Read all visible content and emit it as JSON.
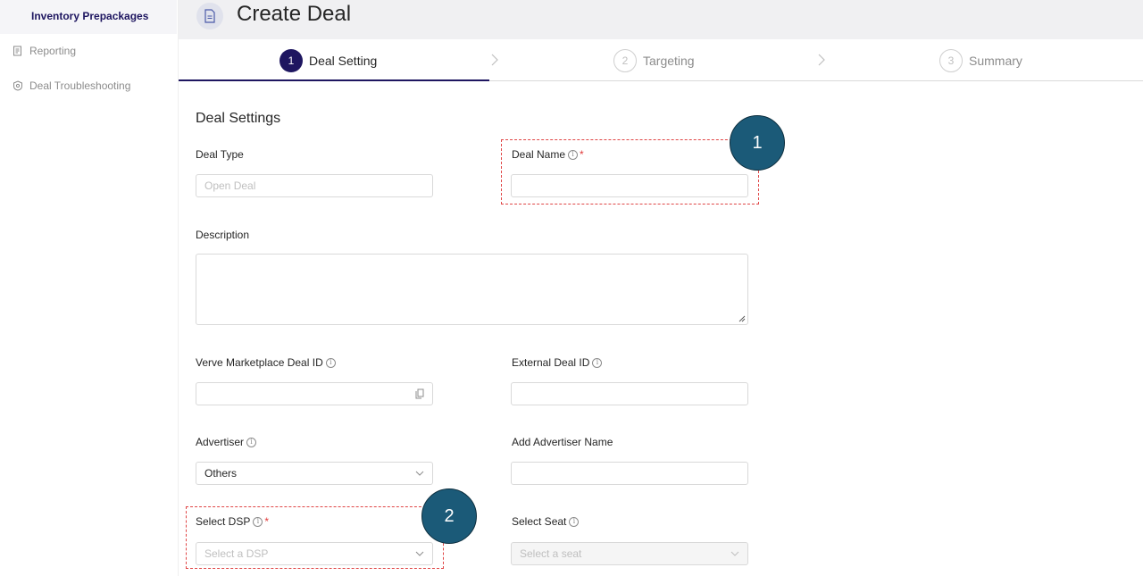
{
  "sidebar": {
    "active_item": "Inventory Prepackages",
    "items": [
      {
        "label": "Reporting",
        "icon": "report-icon"
      },
      {
        "label": "Deal Troubleshooting",
        "icon": "troubleshoot-icon"
      }
    ]
  },
  "header": {
    "title": "Create Deal",
    "icon": "document-icon"
  },
  "steps": [
    {
      "number": "1",
      "label": "Deal Setting",
      "state": "active"
    },
    {
      "number": "2",
      "label": "Targeting",
      "state": "idle"
    },
    {
      "number": "3",
      "label": "Summary",
      "state": "idle"
    }
  ],
  "form": {
    "section_title": "Deal Settings",
    "deal_type": {
      "label": "Deal Type",
      "placeholder": "Open Deal"
    },
    "deal_name": {
      "label": "Deal Name",
      "required_mark": "*",
      "value": ""
    },
    "description": {
      "label": "Description",
      "value": ""
    },
    "marketplace_id": {
      "label": "Verve Marketplace Deal ID",
      "value": ""
    },
    "external_id": {
      "label": "External Deal ID",
      "value": ""
    },
    "advertiser": {
      "label": "Advertiser",
      "value": "Others"
    },
    "add_advertiser": {
      "label": "Add Advertiser Name",
      "value": ""
    },
    "select_dsp": {
      "label": "Select DSP",
      "required_mark": "*",
      "placeholder": "Select a DSP"
    },
    "select_seat": {
      "label": "Select Seat",
      "placeholder": "Select a seat"
    }
  },
  "callouts": [
    {
      "number": "1"
    },
    {
      "number": "2"
    }
  ],
  "colors": {
    "primary": "#1e1660",
    "callout": "#1b5a78",
    "highlight": "#e04646",
    "required": "#e03a3a"
  }
}
